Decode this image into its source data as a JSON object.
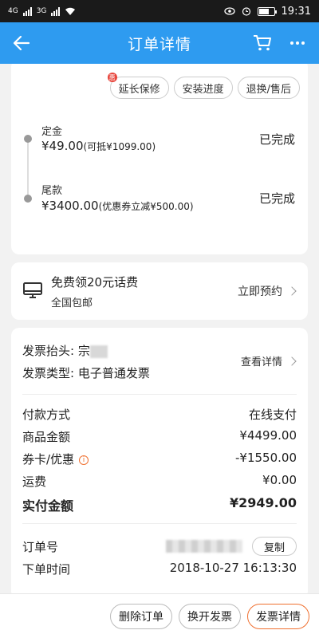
{
  "status_bar": {
    "signal1": "4G",
    "signal2": "3G",
    "battery": "80",
    "time": "19:31"
  },
  "header": {
    "title": "订单详情",
    "back_icon": "arrow-left-icon",
    "cart_icon": "cart-icon",
    "more_icon": "more-dots-icon",
    "color": "#2e9bf0"
  },
  "service_buttons": [
    {
      "label": "延长保修",
      "badge": "惠"
    },
    {
      "label": "安装进度"
    },
    {
      "label": "退换/售后"
    }
  ],
  "payment_steps": [
    {
      "label": "定金",
      "amount": "¥49.00",
      "note": "(可抵¥1099.00)",
      "status": "已完成"
    },
    {
      "label": "尾款",
      "amount": "¥3400.00",
      "note": "(优惠券立减¥500.00)",
      "status": "已完成"
    }
  ],
  "promo": {
    "icon": "monitor-icon",
    "title": "免费领20元话费",
    "subtitle": "全国包邮",
    "action": "立即预约"
  },
  "invoice": {
    "title_label": "发票抬头: 宗",
    "type_label": "发票类型: 电子普通发票",
    "detail_link": "查看详情"
  },
  "summary": [
    {
      "key": "付款方式",
      "value": "在线支付"
    },
    {
      "key": "商品金额",
      "value": "¥4499.00"
    },
    {
      "key": "券卡/优惠",
      "value": "-¥1550.00",
      "info": "i"
    },
    {
      "key": "运费",
      "value": "¥0.00"
    },
    {
      "key": "实付金额",
      "value": "¥2949.00"
    }
  ],
  "order": {
    "number_label": "订单号",
    "copy_label": "复制",
    "time_label": "下单时间",
    "time_value": "2018-10-27 16:13:30"
  },
  "bottom_bar": {
    "delete": "删除订单",
    "change_invoice": "换开发票",
    "invoice_detail": "发票详情",
    "accent": "#f07030"
  }
}
